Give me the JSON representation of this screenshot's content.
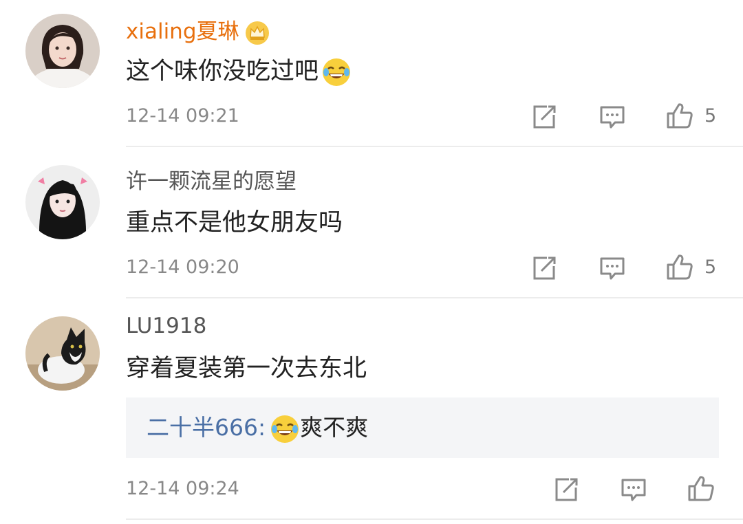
{
  "comments": [
    {
      "username": "xialing夏琳",
      "text": "这个味你没吃过吧",
      "time": "12-14 09:21",
      "likes": "5",
      "vip": true
    },
    {
      "username": "许一颗流星的愿望",
      "text": "重点不是他女朋友吗",
      "time": "12-14 09:20",
      "likes": "5"
    },
    {
      "username": "LU1918",
      "text": "穿着夏装第一次去东北",
      "time": "12-14 09:24",
      "reply": {
        "author": "二十半666:",
        "text": "爽不爽"
      }
    }
  ],
  "colors": {
    "vip_name": "#e8700e",
    "reply_name": "#4a6fa5",
    "icon_gray": "#8a8a8a"
  },
  "icons": [
    "crown-icon",
    "laugh-emoji-icon",
    "repost-icon",
    "comment-icon",
    "like-icon"
  ]
}
